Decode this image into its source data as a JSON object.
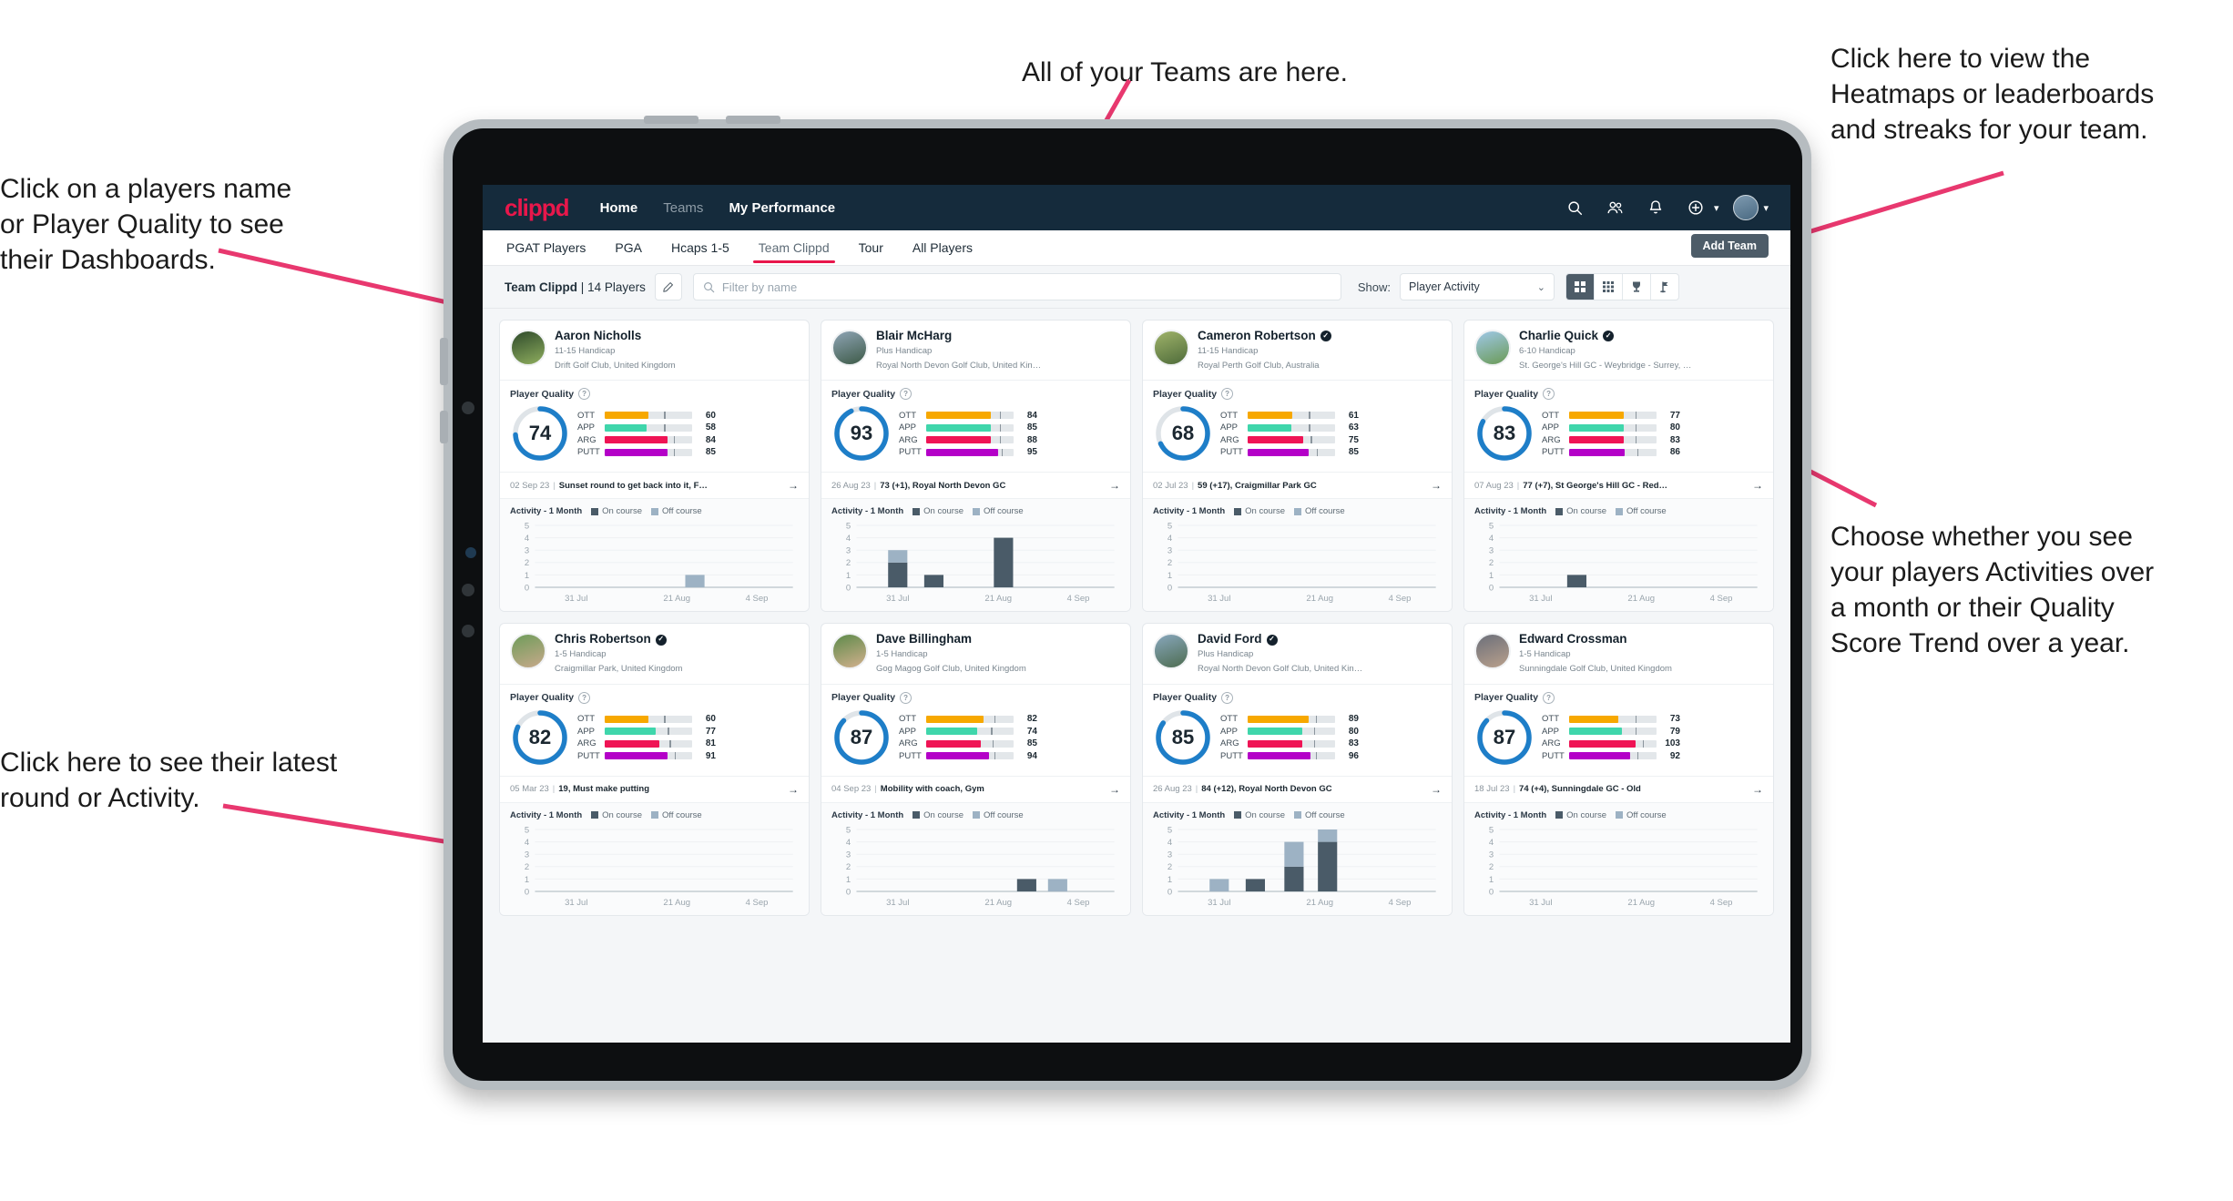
{
  "annotations": {
    "teams": "All of your Teams are here.",
    "heatmaps": "Click here to view the\nHeatmaps or leaderboards\nand streaks for your team.",
    "dashboards": "Click on a players name\nor Player Quality to see\ntheir Dashboards.",
    "choose": "Choose whether you see\nyour players Activities over\na month or their Quality\nScore Trend over a year.",
    "latest_round": "Click here to see their latest\nround or Activity."
  },
  "topnav": {
    "logo": "clippd",
    "links": [
      {
        "label": "Home",
        "active": true
      },
      {
        "label": "Teams",
        "active": false
      },
      {
        "label": "My Performance",
        "active": true
      }
    ],
    "icons": [
      "search-icon",
      "people-icon",
      "bell-icon",
      "plus-circle-icon"
    ]
  },
  "tabs": {
    "items": [
      "PGAT Players",
      "PGA",
      "Hcaps 1-5",
      "Team Clippd",
      "Tour",
      "All Players"
    ],
    "active": "Team Clippd",
    "add_team_label": "Add Team"
  },
  "toolbar": {
    "team_name": "Team Clippd",
    "separator": "|",
    "player_count": "14 Players",
    "search_placeholder": "Filter by name",
    "show_label": "Show:",
    "selected_view": "Player Activity",
    "view_buttons": [
      "grid-large-icon",
      "grid-dense-icon",
      "trophy-icon",
      "flag-icon"
    ],
    "active_view_button": 0
  },
  "colors": {
    "accent_pink": "#e8174b",
    "navy": "#152b3c",
    "ott": "#f7a800",
    "app": "#3fd6ab",
    "arg": "#ef1455",
    "putt": "#b400c8",
    "ring": "#1e7ec8",
    "on_course": "#4a5b68",
    "off_course": "#9db2c4"
  },
  "card_labels": {
    "player_quality": "Player Quality",
    "activity": "Activity - 1 Month",
    "legend_on": "On course",
    "legend_off": "Off course",
    "metrics": [
      "OTT",
      "APP",
      "ARG",
      "PUTT"
    ]
  },
  "chart_data": {
    "type": "bar",
    "title": "Activity - 1 Month",
    "categories": [
      "31 Jul",
      "21 Aug",
      "4 Sep"
    ],
    "xlabel": "",
    "ylabel": "",
    "ylim": [
      0,
      5
    ],
    "yticks": [
      0,
      1,
      2,
      3,
      4,
      5
    ],
    "grid": true,
    "legend": [
      "On course",
      "Off course"
    ],
    "legend_position": "top",
    "stacked": true,
    "per_player": [
      {
        "player": "Aaron Nicholls",
        "bars": [
          {
            "pos": 0.62,
            "on": 0,
            "off": 1
          }
        ]
      },
      {
        "player": "Blair McHarg",
        "bars": [
          {
            "pos": 0.16,
            "on": 2,
            "off": 1
          },
          {
            "pos": 0.3,
            "on": 1,
            "off": 0
          },
          {
            "pos": 0.57,
            "on": 4,
            "off": 0
          }
        ]
      },
      {
        "player": "Cameron Robertson",
        "bars": []
      },
      {
        "player": "Charlie Quick",
        "bars": [
          {
            "pos": 0.3,
            "on": 1,
            "off": 0
          }
        ]
      },
      {
        "player": "Chris Robertson",
        "bars": []
      },
      {
        "player": "Dave Billingham",
        "bars": [
          {
            "pos": 0.66,
            "on": 1,
            "off": 0
          },
          {
            "pos": 0.78,
            "on": 0,
            "off": 1
          }
        ]
      },
      {
        "player": "David Ford",
        "bars": [
          {
            "pos": 0.16,
            "on": 0,
            "off": 1
          },
          {
            "pos": 0.3,
            "on": 1,
            "off": 0
          },
          {
            "pos": 0.45,
            "on": 2,
            "off": 2
          },
          {
            "pos": 0.58,
            "on": 4,
            "off": 1
          }
        ]
      },
      {
        "player": "Edward Crossman",
        "bars": []
      }
    ]
  },
  "players": [
    {
      "name": "Aaron Nicholls",
      "verified": false,
      "handicap": "11-15 Handicap",
      "club": "Drift Golf Club, United Kingdom",
      "quality": 74,
      "metrics": [
        {
          "label": "OTT",
          "value": 60,
          "fill": 0.5,
          "tick": 0.68
        },
        {
          "label": "APP",
          "value": 58,
          "fill": 0.48,
          "tick": 0.68
        },
        {
          "label": "ARG",
          "value": 84,
          "fill": 0.72,
          "tick": 0.79
        },
        {
          "label": "PUTT",
          "value": 85,
          "fill": 0.72,
          "tick": 0.79
        }
      ],
      "last_date": "02 Sep 23",
      "last_text": "Sunset round to get back into it, F…"
    },
    {
      "name": "Blair McHarg",
      "verified": false,
      "handicap": "Plus Handicap",
      "club": "Royal North Devon Golf Club, United Kin…",
      "quality": 93,
      "metrics": [
        {
          "label": "OTT",
          "value": 84,
          "fill": 0.74,
          "tick": 0.84
        },
        {
          "label": "APP",
          "value": 85,
          "fill": 0.74,
          "tick": 0.84
        },
        {
          "label": "ARG",
          "value": 88,
          "fill": 0.74,
          "tick": 0.84
        },
        {
          "label": "PUTT",
          "value": 95,
          "fill": 0.82,
          "tick": 0.86
        }
      ],
      "last_date": "26 Aug 23",
      "last_text": "73 (+1), Royal North Devon GC"
    },
    {
      "name": "Cameron Robertson",
      "verified": true,
      "handicap": "11-15 Handicap",
      "club": "Royal Perth Golf Club, Australia",
      "quality": 68,
      "metrics": [
        {
          "label": "OTT",
          "value": 61,
          "fill": 0.51,
          "tick": 0.7
        },
        {
          "label": "APP",
          "value": 63,
          "fill": 0.5,
          "tick": 0.7
        },
        {
          "label": "ARG",
          "value": 75,
          "fill": 0.64,
          "tick": 0.72
        },
        {
          "label": "PUTT",
          "value": 85,
          "fill": 0.7,
          "tick": 0.79
        }
      ],
      "last_date": "02 Jul 23",
      "last_text": "59 (+17), Craigmillar Park GC"
    },
    {
      "name": "Charlie Quick",
      "verified": true,
      "handicap": "6-10 Handicap",
      "club": "St. George's Hill GC - Weybridge - Surrey, …",
      "quality": 83,
      "metrics": [
        {
          "label": "OTT",
          "value": 77,
          "fill": 0.62,
          "tick": 0.76
        },
        {
          "label": "APP",
          "value": 80,
          "fill": 0.62,
          "tick": 0.76
        },
        {
          "label": "ARG",
          "value": 83,
          "fill": 0.62,
          "tick": 0.76
        },
        {
          "label": "PUTT",
          "value": 86,
          "fill": 0.64,
          "tick": 0.78
        }
      ],
      "last_date": "07 Aug 23",
      "last_text": "77 (+7), St George's Hill GC - Red…"
    },
    {
      "name": "Chris Robertson",
      "verified": true,
      "handicap": "1-5 Handicap",
      "club": "Craigmillar Park, United Kingdom",
      "quality": 82,
      "metrics": [
        {
          "label": "OTT",
          "value": 60,
          "fill": 0.5,
          "tick": 0.68
        },
        {
          "label": "APP",
          "value": 77,
          "fill": 0.58,
          "tick": 0.72
        },
        {
          "label": "ARG",
          "value": 81,
          "fill": 0.62,
          "tick": 0.74
        },
        {
          "label": "PUTT",
          "value": 91,
          "fill": 0.72,
          "tick": 0.8
        }
      ],
      "last_date": "05 Mar 23",
      "last_text": "19, Must make putting"
    },
    {
      "name": "Dave Billingham",
      "verified": false,
      "handicap": "1-5 Handicap",
      "club": "Gog Magog Golf Club, United Kingdom",
      "quality": 87,
      "metrics": [
        {
          "label": "OTT",
          "value": 82,
          "fill": 0.66,
          "tick": 0.78
        },
        {
          "label": "APP",
          "value": 74,
          "fill": 0.58,
          "tick": 0.74
        },
        {
          "label": "ARG",
          "value": 85,
          "fill": 0.62,
          "tick": 0.76
        },
        {
          "label": "PUTT",
          "value": 94,
          "fill": 0.72,
          "tick": 0.78
        }
      ],
      "last_date": "04 Sep 23",
      "last_text": "Mobility with coach, Gym"
    },
    {
      "name": "David Ford",
      "verified": true,
      "handicap": "Plus Handicap",
      "club": "Royal North Devon Golf Club, United Kin…",
      "quality": 85,
      "metrics": [
        {
          "label": "OTT",
          "value": 89,
          "fill": 0.7,
          "tick": 0.78
        },
        {
          "label": "APP",
          "value": 80,
          "fill": 0.62,
          "tick": 0.76
        },
        {
          "label": "ARG",
          "value": 83,
          "fill": 0.62,
          "tick": 0.76
        },
        {
          "label": "PUTT",
          "value": 96,
          "fill": 0.72,
          "tick": 0.78
        }
      ],
      "last_date": "26 Aug 23",
      "last_text": "84 (+12), Royal North Devon GC"
    },
    {
      "name": "Edward Crossman",
      "verified": false,
      "handicap": "1-5 Handicap",
      "club": "Sunningdale Golf Club, United Kingdom",
      "quality": 87,
      "metrics": [
        {
          "label": "OTT",
          "value": 73,
          "fill": 0.56,
          "tick": 0.76
        },
        {
          "label": "APP",
          "value": 79,
          "fill": 0.6,
          "tick": 0.76
        },
        {
          "label": "ARG",
          "value": 103,
          "fill": 0.76,
          "tick": 0.84
        },
        {
          "label": "PUTT",
          "value": 92,
          "fill": 0.7,
          "tick": 0.78
        }
      ],
      "last_date": "18 Jul 23",
      "last_text": "74 (+4), Sunningdale GC - Old"
    }
  ]
}
